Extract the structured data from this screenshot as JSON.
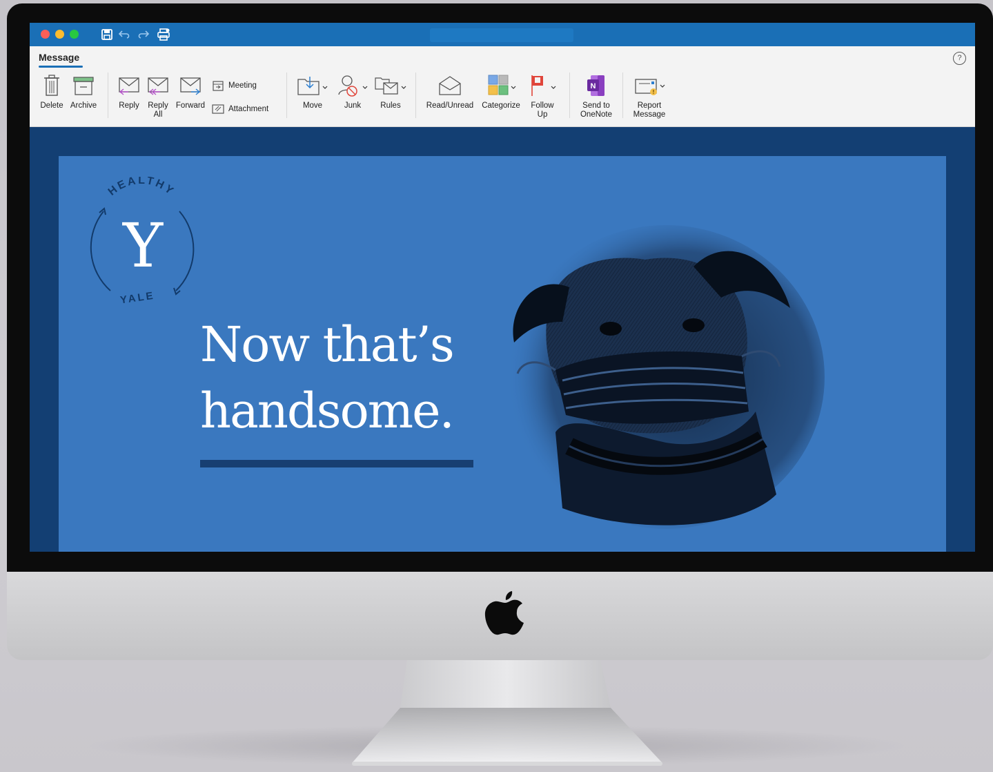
{
  "window": {
    "traffic_lights": {
      "close": "#fe5f57",
      "minimize": "#febc2e",
      "zoom": "#28c840"
    },
    "title_bar_color": "#1a6fb6",
    "toolbar_icons": [
      "save-icon",
      "undo-icon",
      "redo-icon",
      "print-icon"
    ]
  },
  "ribbon": {
    "tab": "Message",
    "help": "?",
    "buttons": {
      "delete": "Delete",
      "archive": "Archive",
      "reply": "Reply",
      "reply_all_1": "Reply",
      "reply_all_2": "All",
      "forward": "Forward",
      "meeting": "Meeting",
      "attachment": "Attachment",
      "move": "Move",
      "junk": "Junk",
      "rules": "Rules",
      "read_unread": "Read/Unread",
      "categorize": "Categorize",
      "follow_up_1": "Follow",
      "follow_up_2": "Up",
      "send_onenote_1": "Send to",
      "send_onenote_2": "OneNote",
      "report_1": "Report",
      "report_2": "Message"
    }
  },
  "email": {
    "background": "#3a78bf",
    "frame": "#133f73",
    "logo": {
      "top_text": "HEALTHY",
      "letter": "Y",
      "bottom_text": "YALE"
    },
    "headline_line1": "Now that’s",
    "headline_line2": "handsome."
  }
}
